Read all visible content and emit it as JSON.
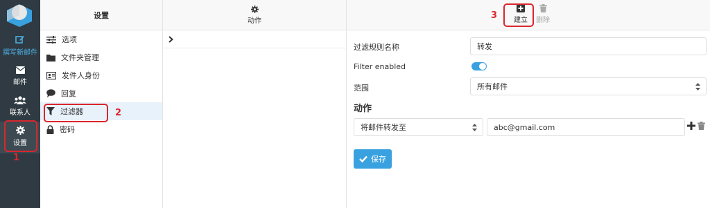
{
  "rail": {
    "compose_label": "撰写新邮件",
    "mail_label": "邮件",
    "contacts_label": "联系人",
    "settings_label": "设置"
  },
  "settings_column": {
    "title": "设置",
    "items": [
      {
        "label": "选项",
        "icon": "sliders-icon"
      },
      {
        "label": "文件夹管理",
        "icon": "folder-icon"
      },
      {
        "label": "发件人身份",
        "icon": "id-card-icon"
      },
      {
        "label": "回复",
        "icon": "comment-icon"
      },
      {
        "label": "过滤器",
        "icon": "filter-icon"
      },
      {
        "label": "密码",
        "icon": "lock-icon"
      }
    ]
  },
  "list_column": {
    "actions_label": "动作"
  },
  "toolbar": {
    "create_label": "建立",
    "delete_label": "删除"
  },
  "form": {
    "rule_name_label": "过滤规则名称",
    "rule_name_value": "转发",
    "filter_enabled_label": "Filter enabled",
    "scope_label": "范围",
    "scope_value": "所有邮件",
    "actions_title": "动作",
    "action_value": "将邮件转发至",
    "forward_address_value": "abc@gmail.com",
    "save_label": "保存"
  },
  "annotations": {
    "step1": "1",
    "step2": "2",
    "step3": "3"
  },
  "colors": {
    "rail_bg": "#2f3a42",
    "accent": "#3aa1e0",
    "annotation": "#d9262e"
  }
}
